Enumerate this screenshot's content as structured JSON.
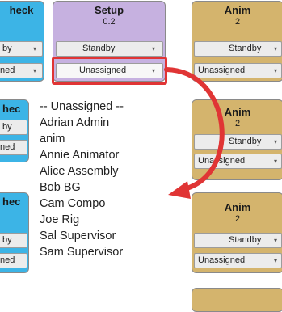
{
  "columns": [
    {
      "id": "check",
      "title": "heck",
      "selects": [
        "by",
        "ned"
      ]
    },
    {
      "id": "setup",
      "title": "Setup",
      "version": "0.2",
      "selects": [
        "Standby",
        "Unassigned"
      ]
    },
    {
      "id": "anim",
      "title": "Anim",
      "version": "2",
      "selects": [
        "Standby",
        "Unassigned"
      ]
    }
  ],
  "left_rows": [
    {
      "title": "hec",
      "selects": [
        "by",
        "ned"
      ]
    },
    {
      "title": "hec",
      "selects": [
        "by",
        "ned"
      ]
    }
  ],
  "right_rows": [
    {
      "title": "Anim",
      "version": "2",
      "selects": [
        "Standby",
        "Unassigned"
      ]
    },
    {
      "title": "Anim",
      "version": "2",
      "selects": [
        "Standby",
        "Unassigned"
      ]
    }
  ],
  "dropdown": {
    "options": [
      "-- Unassigned --",
      "Adrian Admin",
      "anim",
      "Annie Animator",
      "Alice Assembly",
      "Bob BG",
      "Cam Compo",
      "Joe Rig",
      "Sal Supervisor",
      "Sam Supervisor"
    ]
  },
  "colors": {
    "check": "#3cb4e6",
    "setup": "#c6b1e0",
    "anim": "#d4b46d",
    "annotation": "#e03535"
  },
  "icons": {
    "caret": "chevron-down-icon",
    "annotation_arrow": "curved-arrow-icon"
  }
}
